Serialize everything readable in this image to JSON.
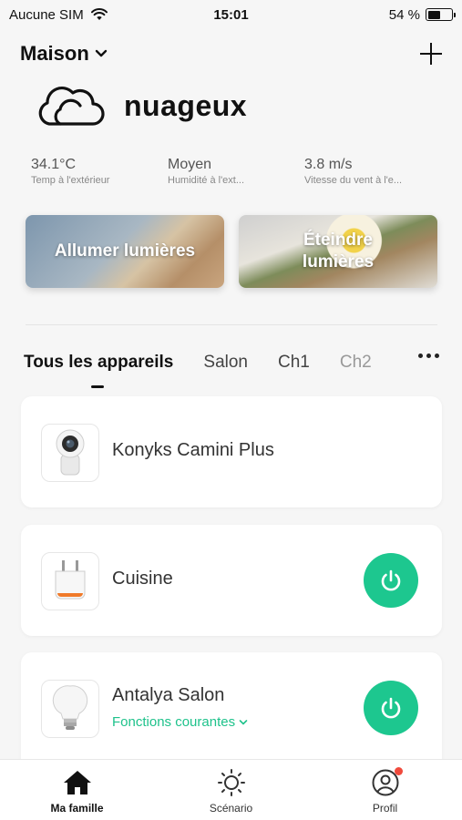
{
  "status_bar": {
    "carrier": "Aucune SIM",
    "time": "15:01",
    "battery_percent": "54 %",
    "battery_level": 0.54
  },
  "header": {
    "home_name": "Maison",
    "icons": [
      "chevron-down-icon",
      "plus-icon"
    ]
  },
  "weather": {
    "icon": "cloud-icon",
    "condition": "nuageux",
    "stats": [
      {
        "value": "34.1°C",
        "label": "Temp à l'extérieur"
      },
      {
        "value": "Moyen",
        "label": "Humidité à l'ext..."
      },
      {
        "value": "3.8 m/s",
        "label": "Vitesse du vent à l'e..."
      }
    ]
  },
  "scenes": [
    {
      "label": "Allumer lumières"
    },
    {
      "label": "Éteindre lumières"
    }
  ],
  "tabs": {
    "items": [
      {
        "label": "Tous les appareils"
      },
      {
        "label": "Salon"
      },
      {
        "label": "Ch1"
      },
      {
        "label": "Ch2"
      }
    ],
    "active_index": 0,
    "more_icon": "more-dots-icon"
  },
  "devices": [
    {
      "name": "Konyks Camini Plus",
      "icon": "camera-icon"
    },
    {
      "name": "Cuisine",
      "icon": "smart-plug-icon",
      "power_icon": "power-icon"
    },
    {
      "name": "Antalya Salon",
      "icon": "bulb-icon",
      "sub_label": "Fonctions courantes",
      "power_icon": "power-icon"
    }
  ],
  "bottom_nav": {
    "items": [
      {
        "label": "Ma famille",
        "icon": "home-icon"
      },
      {
        "label": "Scénario",
        "icon": "sun-icon"
      },
      {
        "label": "Profil",
        "icon": "profile-icon"
      }
    ],
    "active_index": 0
  },
  "colors": {
    "accent": "#1dc78f",
    "notify": "#f04a3c"
  }
}
